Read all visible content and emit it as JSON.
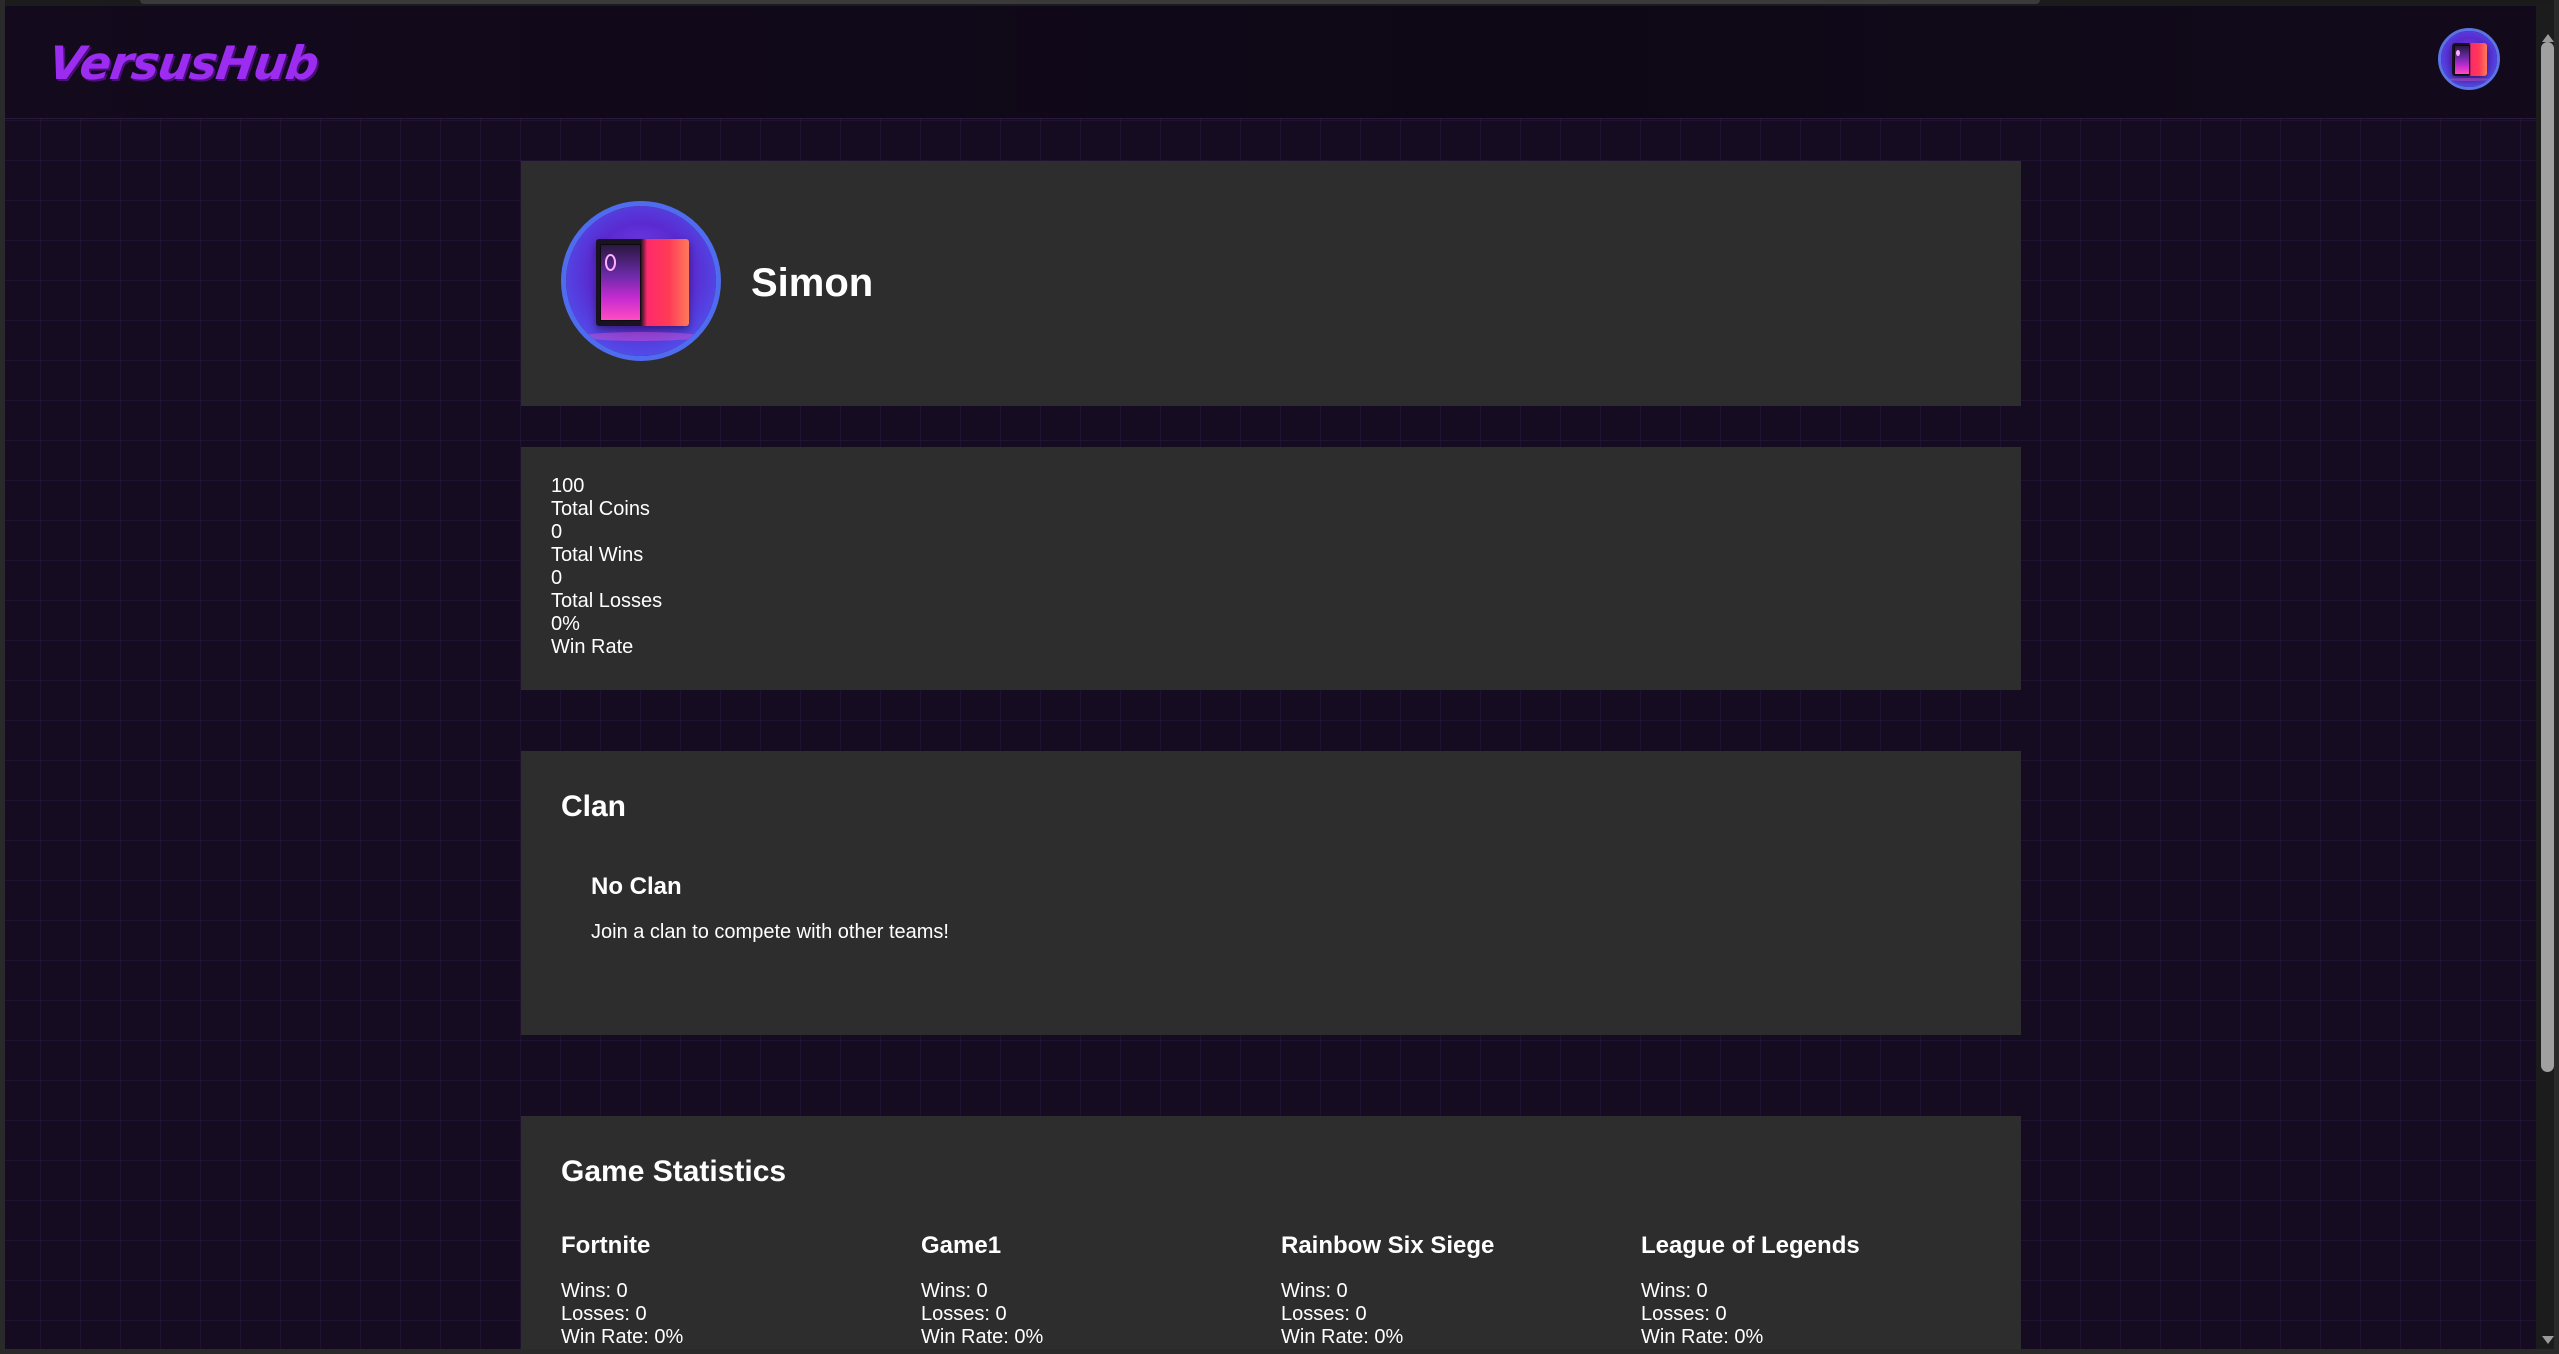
{
  "app": {
    "logo_text": "VersusHub"
  },
  "header": {
    "avatar_icon": "user-avatar-pc-icon"
  },
  "profile": {
    "username": "Simon",
    "avatar_icon": "pc-tower-avatar-icon"
  },
  "stats": {
    "total_coins_value": "100",
    "total_coins_label": "Total Coins",
    "total_wins_value": "0",
    "total_wins_label": "Total Wins",
    "total_losses_value": "0",
    "total_losses_label": "Total Losses",
    "win_rate_value": "0%",
    "win_rate_label": "Win Rate"
  },
  "clan": {
    "title": "Clan",
    "name": "No Clan",
    "description": "Join a clan to compete with other teams!"
  },
  "game_statistics": {
    "title": "Game Statistics",
    "games": [
      {
        "name": "Fortnite",
        "wins": "Wins: 0",
        "losses": "Losses: 0",
        "win_rate": "Win Rate: 0%"
      },
      {
        "name": "Game1",
        "wins": "Wins: 0",
        "losses": "Losses: 0",
        "win_rate": "Win Rate: 0%"
      },
      {
        "name": "Rainbow Six Siege",
        "wins": "Wins: 0",
        "losses": "Losses: 0",
        "win_rate": "Win Rate: 0%"
      },
      {
        "name": "League of Legends",
        "wins": "Wins: 0",
        "losses": "Losses: 0",
        "win_rate": "Win Rate: 0%"
      }
    ]
  },
  "colors": {
    "background": "#150c22",
    "card": "#2d2d2d",
    "logo": "#9b2cf0",
    "avatar_border": "#4f6cf0"
  }
}
